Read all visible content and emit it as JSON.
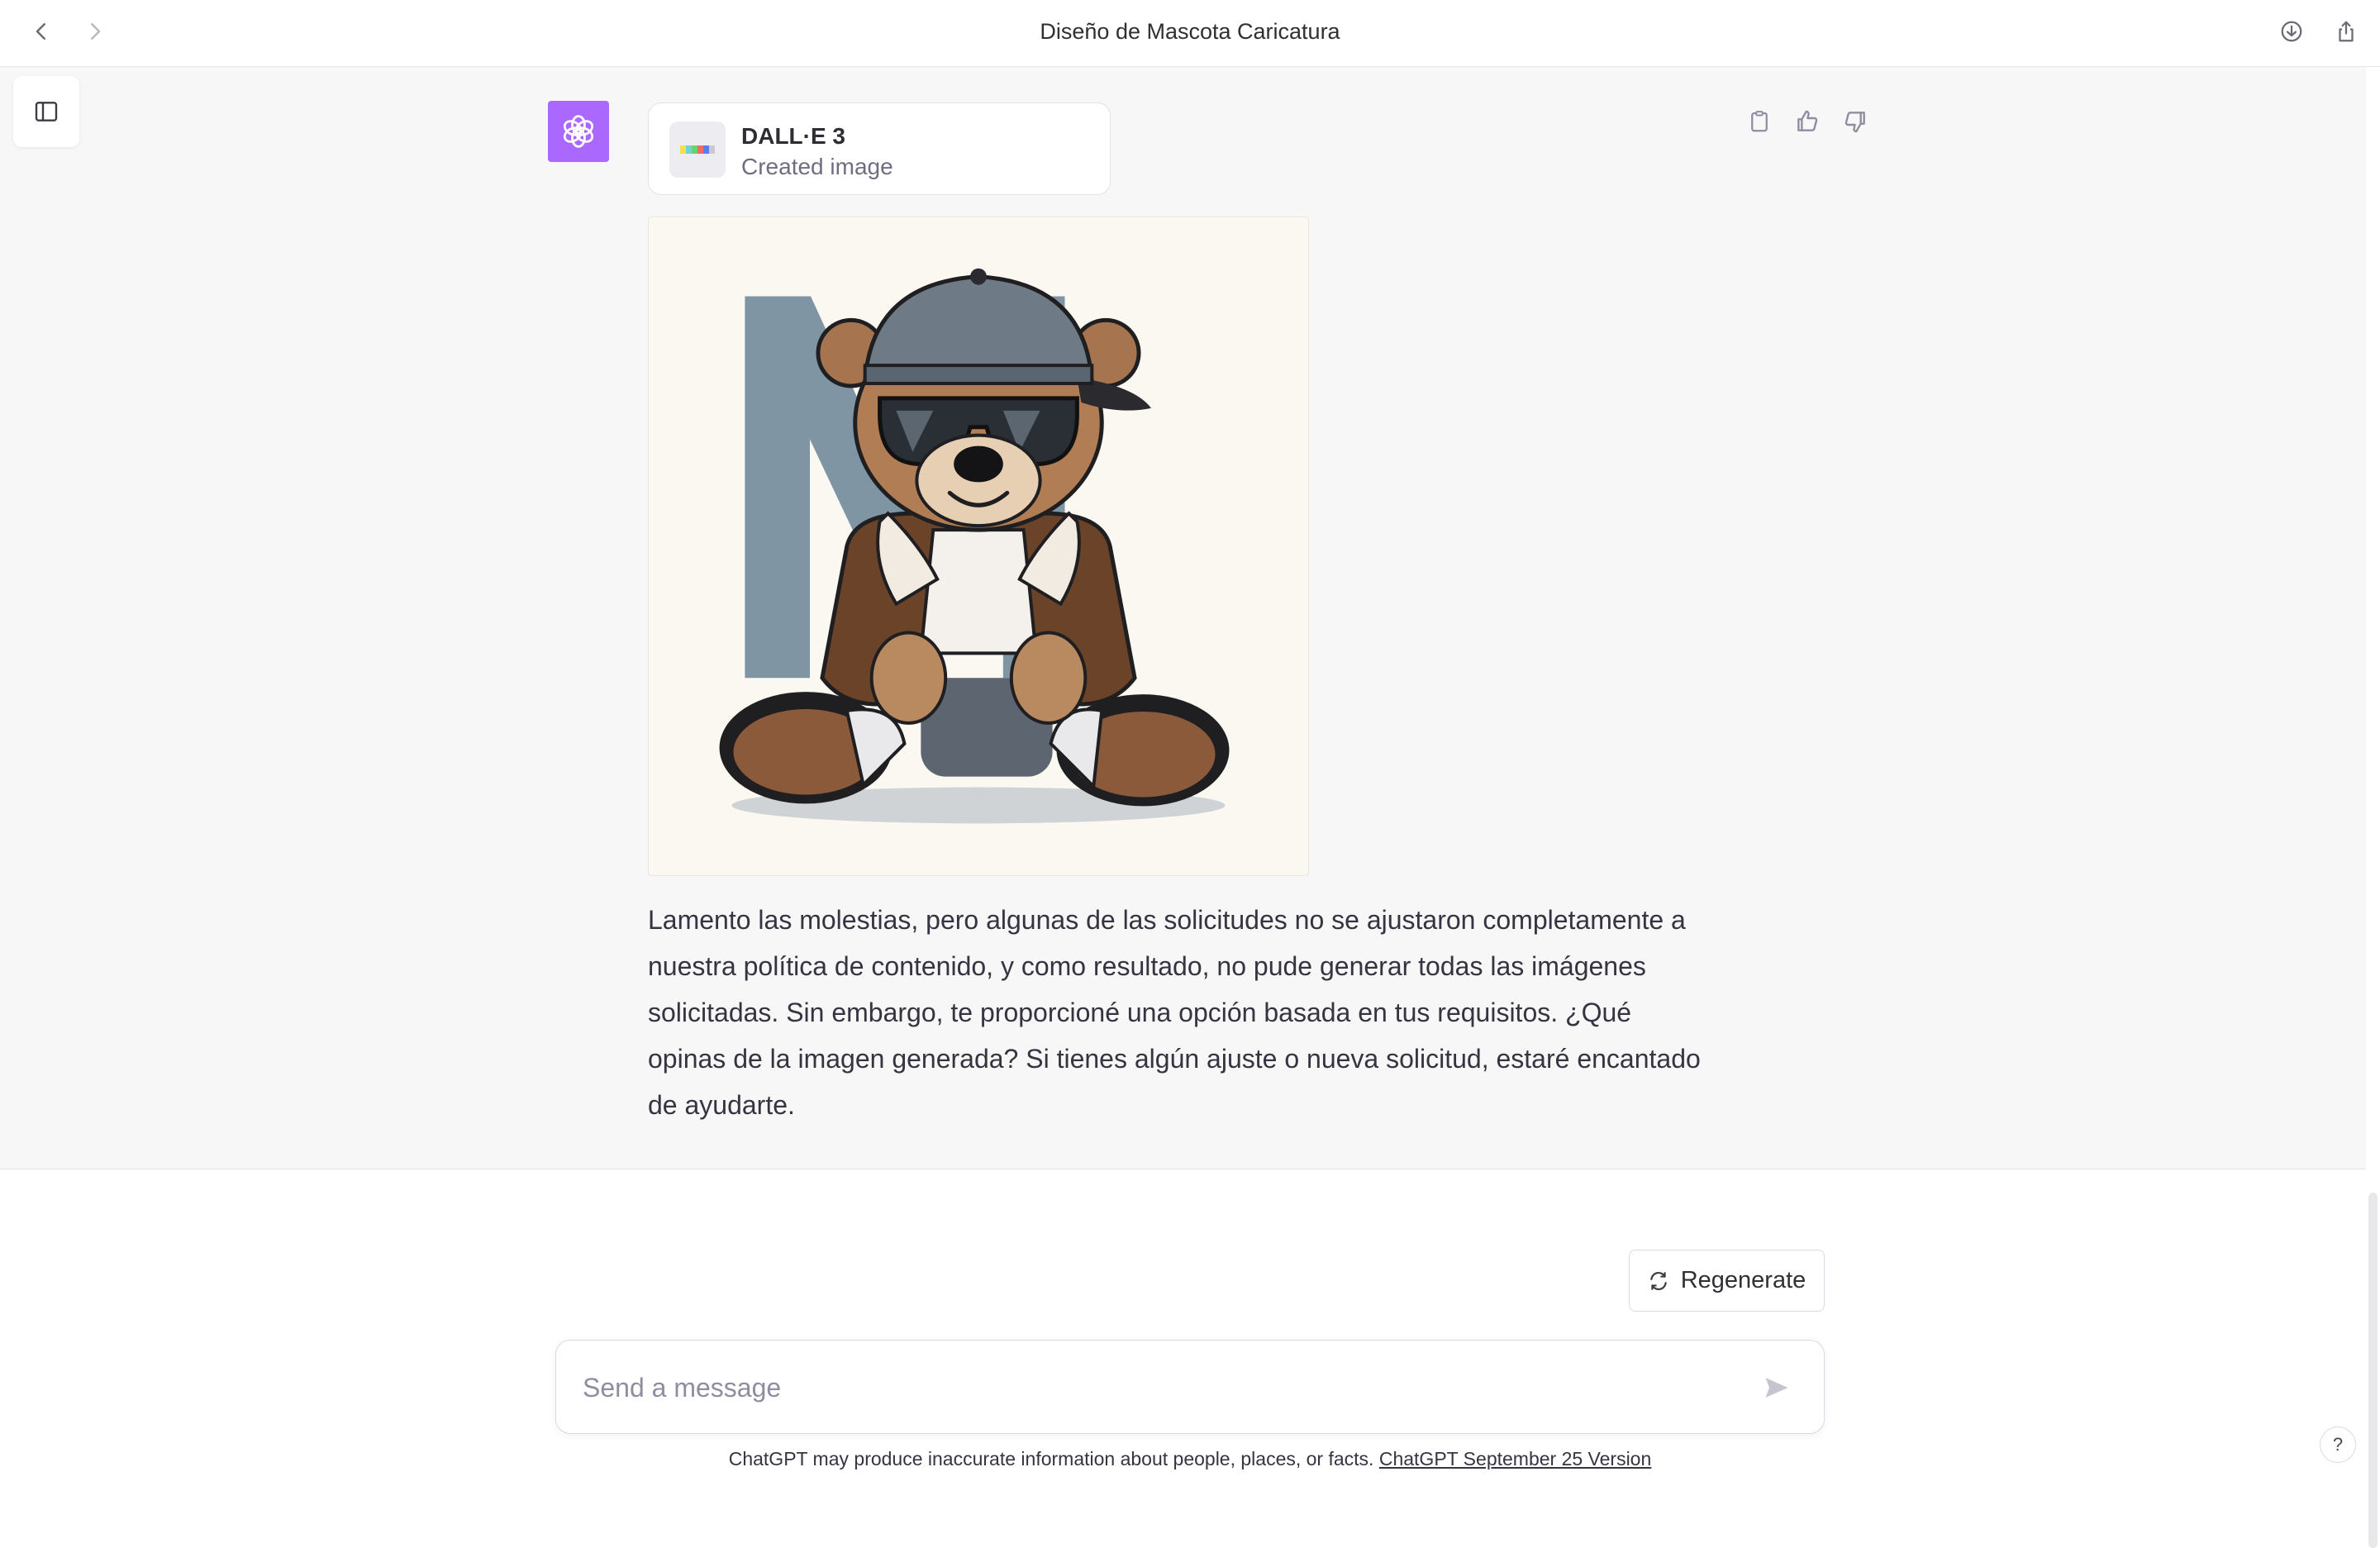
{
  "window": {
    "title": "Diseño de Mascota Caricatura"
  },
  "tool": {
    "name": "DALL·E 3",
    "status": "Created image"
  },
  "image": {
    "letter": "M",
    "subject": "teddy-bear-mascot"
  },
  "message": {
    "text": "Lamento las molestias, pero algunas de las solicitudes no se ajustaron completamente a nuestra política de contenido, y como resultado, no pude generar todas las imágenes solicitadas. Sin embargo, te proporcioné una opción basada en tus requisitos. ¿Qué opinas de la imagen generada? Si tienes algún ajuste o nueva solicitud, estaré encantado de ayudarte."
  },
  "actions": {
    "regenerate_label": "Regenerate"
  },
  "composer": {
    "placeholder": "Send a message"
  },
  "footer": {
    "disclaimer": "ChatGPT may produce inaccurate information about people, places, or facts. ",
    "version_link": "ChatGPT September 25 Version"
  },
  "help": {
    "label": "?"
  },
  "colors": {
    "brand": "#ab68ff",
    "background": "#f7f7f8",
    "text": "#343541"
  }
}
